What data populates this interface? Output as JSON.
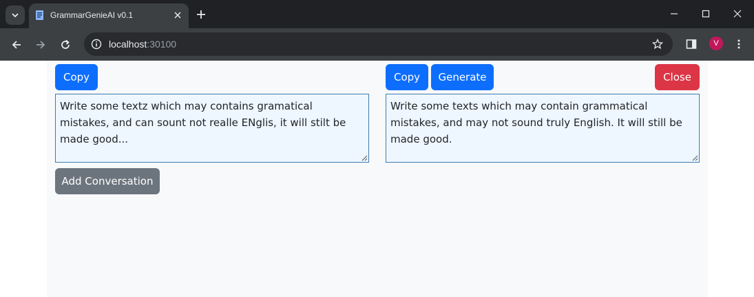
{
  "browser": {
    "tab_title": "GrammarGenieAI v0.1",
    "url_host": "localhost",
    "url_port": ":30100",
    "profile_initial": "V"
  },
  "left_panel": {
    "copy_label": "Copy",
    "text": "Write some textz which may contains gramatical mistakes, and can sount not realle ENglis, it will stilt be made good...",
    "add_conversation_label": "Add Conversation"
  },
  "right_panel": {
    "copy_label": "Copy",
    "generate_label": "Generate",
    "close_label": "Close",
    "text": "Write some texts which may contain grammatical mistakes, and may not sound truly English. It will still be made good."
  },
  "colors": {
    "primary": "#0d6efd",
    "danger": "#dc3545",
    "secondary": "#6c757d"
  }
}
